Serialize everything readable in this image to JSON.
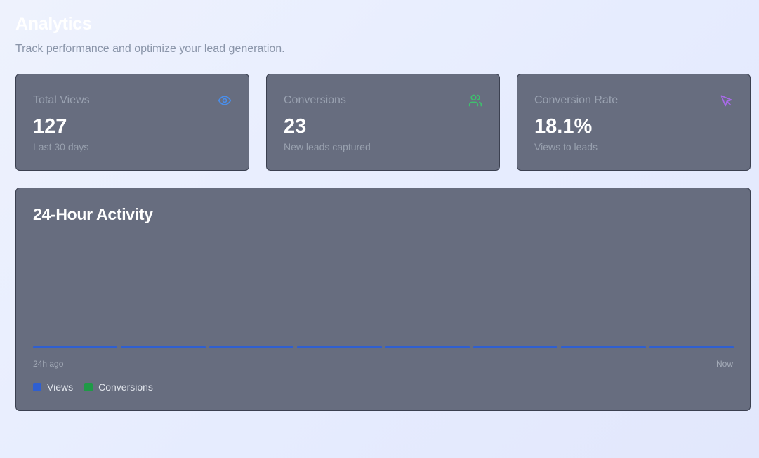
{
  "header": {
    "title": "Analytics",
    "subtitle": "Track performance and optimize your lead generation."
  },
  "cards": [
    {
      "label": "Total Views",
      "value": "127",
      "sub": "Last 30 days",
      "icon": "eye-icon",
      "icon_color": "#4a8eea"
    },
    {
      "label": "Conversions",
      "value": "23",
      "sub": "New leads captured",
      "icon": "users-icon",
      "icon_color": "#3fbf6e"
    },
    {
      "label": "Conversion Rate",
      "value": "18.1%",
      "sub": "Views to leads",
      "icon": "cursor-icon",
      "icon_color": "#a86ae8"
    }
  ],
  "activity": {
    "title": "24-Hour Activity",
    "axis_start": "24h ago",
    "axis_end": "Now",
    "legend": [
      {
        "label": "Views",
        "color": "#2f5fd0"
      },
      {
        "label": "Conversions",
        "color": "#1f9a47"
      }
    ],
    "bar_color": "#2f5fd0",
    "segments": 8
  }
}
